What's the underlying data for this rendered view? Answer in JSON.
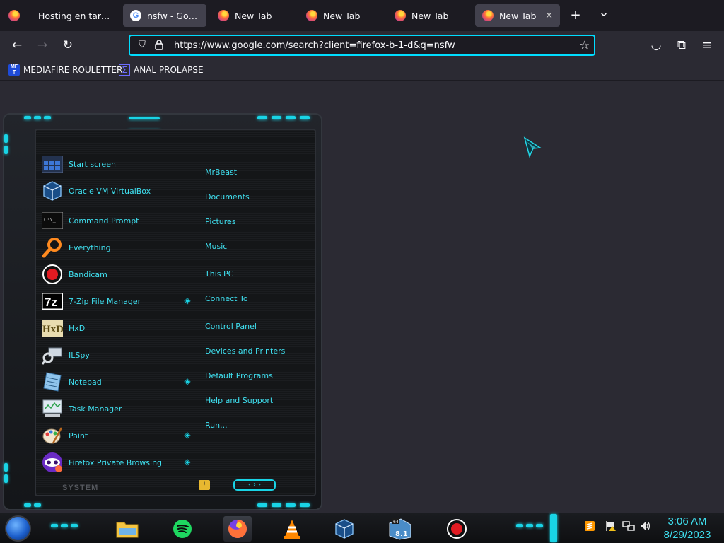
{
  "browser": {
    "tabs": [
      {
        "title": "Hosting en tareas d",
        "icon": "firefox-icon",
        "active": false
      },
      {
        "title": "nsfw - Google S",
        "icon": "google-icon",
        "active": true
      },
      {
        "title": "New Tab",
        "icon": "firefox-icon",
        "active": false
      },
      {
        "title": "New Tab",
        "icon": "firefox-icon",
        "active": false
      },
      {
        "title": "New Tab",
        "icon": "firefox-icon",
        "active": false
      },
      {
        "title": "New Tab",
        "icon": "firefox-icon",
        "active": false
      }
    ],
    "tab_close_glyph": "✕",
    "new_tab_glyph": "+",
    "tab_list_glyph": "⌄",
    "url": "https://www.google.com/search?client=firefox-b-1-d&q=nsfw",
    "nav": {
      "back": "←",
      "forward": "→",
      "reload": "↻",
      "pocket": "◡",
      "extensions": "⧉",
      "menu": "≡",
      "bookmark_star": "☆",
      "shield": "⛉",
      "lock": "🔒"
    },
    "bookmarks": [
      {
        "label": "MEDIAFIRE ROULETTER",
        "icon": "mediafire-icon",
        "icon_text": "MF\nT"
      },
      {
        "label": "ANAL PROLAPSE",
        "icon": "sigma-icon",
        "icon_text": "Σ"
      }
    ]
  },
  "start_menu": {
    "apps": [
      {
        "label": "Start screen",
        "icon": "start-screen-icon",
        "has_submenu": false
      },
      {
        "label": "Oracle VM VirtualBox",
        "icon": "virtualbox-icon",
        "has_submenu": false
      },
      {
        "label": "Command Prompt",
        "icon": "command-prompt-icon",
        "has_submenu": false
      },
      {
        "label": "Everything",
        "icon": "everything-search-icon",
        "has_submenu": false
      },
      {
        "label": "Bandicam",
        "icon": "bandicam-icon",
        "has_submenu": false
      },
      {
        "label": "7-Zip File Manager",
        "icon": "7zip-icon",
        "has_submenu": true
      },
      {
        "label": "HxD",
        "icon": "hxd-icon",
        "has_submenu": false
      },
      {
        "label": "ILSpy",
        "icon": "ilspy-icon",
        "has_submenu": false
      },
      {
        "label": "Notepad",
        "icon": "notepad-icon",
        "has_submenu": true
      },
      {
        "label": "Task Manager",
        "icon": "task-manager-icon",
        "has_submenu": false
      },
      {
        "label": "Paint",
        "icon": "paint-icon",
        "has_submenu": true
      },
      {
        "label": "Firefox Private Browsing",
        "icon": "firefox-private-icon",
        "has_submenu": true
      }
    ],
    "links": [
      "MrBeast",
      "Documents",
      "Pictures",
      "Music",
      "This PC",
      "Connect To",
      "Control Panel",
      "Devices and Printers",
      "Default Programs",
      "Help and Support",
      "Run..."
    ],
    "system_label": "SYSTEM",
    "pager": "‹ › ›",
    "accent_color": "#19d4e6",
    "text_color": "#3fe0f0"
  },
  "taskbar": {
    "pinned": [
      {
        "name": "file-explorer-icon"
      },
      {
        "name": "spotify-icon"
      },
      {
        "name": "firefox-icon",
        "active": true
      },
      {
        "name": "vlc-icon"
      },
      {
        "name": "virtualbox-icon"
      },
      {
        "name": "windows-8-1-icon",
        "badge_top": "64",
        "badge_bottom": "8.1"
      },
      {
        "name": "bandicam-icon"
      }
    ],
    "clock": {
      "time": "3:06 AM",
      "date": "8/29/2023"
    }
  }
}
